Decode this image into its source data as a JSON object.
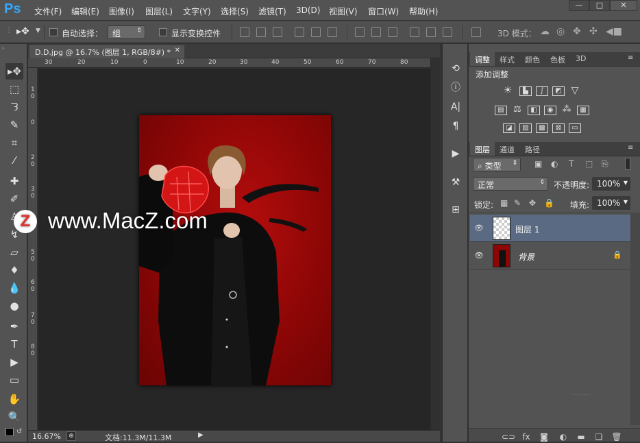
{
  "app": {
    "logo": "Ps",
    "accent": "#31a8ff"
  },
  "menu": [
    "文件(F)",
    "编辑(E)",
    "图像(I)",
    "图层(L)",
    "文字(Y)",
    "选择(S)",
    "滤镜(T)",
    "3D(D)",
    "视图(V)",
    "窗口(W)",
    "帮助(H)"
  ],
  "window_controls": {
    "minimize": "—",
    "restore": "□",
    "close": "✕"
  },
  "options": {
    "auto_select_label": "自动选择：",
    "auto_select_value": "组",
    "show_transform_label": "显示变换控件",
    "mode3d_label": "3D 模式："
  },
  "document": {
    "tab_title": "D.D.jpg @ 16.7% (图层 1, RGB/8#) *",
    "close": "✕",
    "ruler_top": [
      "30",
      "20",
      "10",
      "0",
      "10",
      "20",
      "30",
      "40",
      "50",
      "60",
      "70",
      "80"
    ],
    "ruler_left": [
      "1",
      "0",
      "0",
      "2",
      "0",
      "3",
      "0",
      "4",
      "0",
      "5",
      "0",
      "6",
      "0",
      "7",
      "0",
      "8",
      "0"
    ],
    "background_color": "#8c0606"
  },
  "status": {
    "zoom": "16.67%",
    "doc_info": "文档:11.3M/11.3M"
  },
  "panels": {
    "adjust_tabs": [
      "调整",
      "样式",
      "颜色",
      "色板",
      "3D"
    ],
    "adjust_title": "添加调整",
    "layers_tabs": [
      "图层",
      "通道",
      "路径"
    ],
    "filter_kind": "类型",
    "blend_mode": "正常",
    "opacity_label": "不透明度:",
    "opacity_value": "100%",
    "lock_label": "锁定:",
    "fill_label": "填充:",
    "fill_value": "100%",
    "layers": [
      {
        "name": "图层 1",
        "selected": true
      },
      {
        "name": "背景",
        "locked": true
      }
    ],
    "tiny_text": "· · · · · · · · · · ·"
  },
  "watermark": {
    "logo": "Z",
    "text": "www.MacZ.com"
  }
}
